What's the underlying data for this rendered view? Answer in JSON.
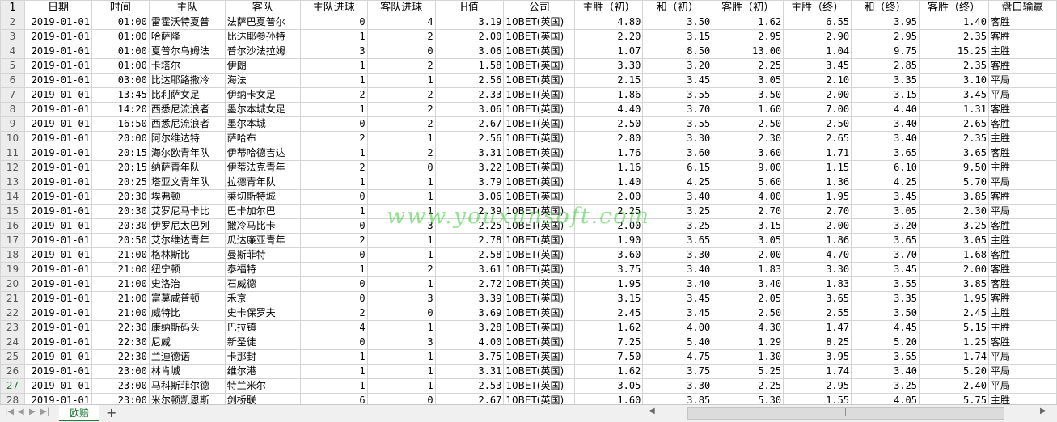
{
  "columns": [
    "日期",
    "时间",
    "主队",
    "客队",
    "主队进球",
    "客队进球",
    "H值",
    "公司",
    "主胜（初）",
    "和（初）",
    "客胜（初）",
    "主胜（终）",
    "和（终）",
    "客胜（终）",
    "盘口输赢"
  ],
  "rows": [
    [
      "2",
      "2019-01-01",
      "01:00",
      "雷霍沃特夏普",
      "法萨巴夏普尔",
      "0",
      "4",
      "3.19",
      "10BET(英国)",
      "4.80",
      "3.50",
      "1.62",
      "6.55",
      "3.95",
      "1.40",
      "客胜"
    ],
    [
      "3",
      "2019-01-01",
      "01:00",
      "哈萨隆",
      "比达耶参孙特",
      "1",
      "2",
      "2.00",
      "10BET(英国)",
      "2.20",
      "3.15",
      "2.95",
      "2.90",
      "2.95",
      "2.35",
      "客胜"
    ],
    [
      "4",
      "2019-01-01",
      "01:00",
      "夏普尔乌姆法",
      "普尔沙法拉姆",
      "3",
      "0",
      "3.06",
      "10BET(英国)",
      "1.07",
      "8.50",
      "13.00",
      "1.04",
      "9.75",
      "15.25",
      "主胜"
    ],
    [
      "5",
      "2019-01-01",
      "01:00",
      "卡塔尔",
      "伊朗",
      "1",
      "2",
      "1.58",
      "10BET(英国)",
      "3.30",
      "3.20",
      "2.25",
      "3.45",
      "2.85",
      "2.35",
      "客胜"
    ],
    [
      "6",
      "2019-01-01",
      "03:00",
      "比达耶路撒冷",
      "海法",
      "1",
      "1",
      "2.56",
      "10BET(英国)",
      "2.15",
      "3.45",
      "3.05",
      "2.10",
      "3.35",
      "3.10",
      "平局"
    ],
    [
      "7",
      "2019-01-01",
      "13:45",
      "比利萨女足",
      "伊纳卡女足",
      "2",
      "2",
      "2.33",
      "10BET(英国)",
      "1.86",
      "3.55",
      "3.50",
      "2.00",
      "3.15",
      "3.45",
      "平局"
    ],
    [
      "8",
      "2019-01-01",
      "14:20",
      "西悉尼流浪者",
      "墨尔本城女足",
      "1",
      "2",
      "3.06",
      "10BET(英国)",
      "4.40",
      "3.70",
      "1.60",
      "7.00",
      "4.40",
      "1.31",
      "客胜"
    ],
    [
      "9",
      "2019-01-01",
      "16:50",
      "西悉尼流浪者",
      "墨尔本城",
      "0",
      "2",
      "2.67",
      "10BET(英国)",
      "2.50",
      "3.55",
      "2.50",
      "2.50",
      "3.40",
      "2.65",
      "客胜"
    ],
    [
      "10",
      "2019-01-01",
      "20:00",
      "阿尔维达特",
      "萨哈布",
      "2",
      "1",
      "2.56",
      "10BET(英国)",
      "2.80",
      "3.30",
      "2.30",
      "2.65",
      "3.40",
      "2.35",
      "主胜"
    ],
    [
      "11",
      "2019-01-01",
      "20:15",
      "海尔欧青年队",
      "伊蒂哈德吉达",
      "1",
      "2",
      "3.31",
      "10BET(英国)",
      "1.76",
      "3.60",
      "3.60",
      "1.71",
      "3.65",
      "3.65",
      "客胜"
    ],
    [
      "12",
      "2019-01-01",
      "20:15",
      "纳萨青年队",
      "伊蒂法克青年",
      "2",
      "0",
      "3.22",
      "10BET(英国)",
      "1.16",
      "6.15",
      "9.00",
      "1.15",
      "6.10",
      "9.50",
      "主胜"
    ],
    [
      "13",
      "2019-01-01",
      "20:25",
      "塔亚文青年队",
      "拉德青年队",
      "1",
      "1",
      "3.79",
      "10BET(英国)",
      "1.40",
      "4.25",
      "5.60",
      "1.36",
      "4.25",
      "5.70",
      "平局"
    ],
    [
      "14",
      "2019-01-01",
      "20:30",
      "埃弗顿",
      "莱切斯特城",
      "0",
      "1",
      "3.06",
      "10BET(英国)",
      "2.00",
      "3.40",
      "4.00",
      "1.95",
      "3.45",
      "3.85",
      "客胜"
    ],
    [
      "15",
      "2019-01-01",
      "20:30",
      "艾罗尼马卡比",
      "巴卡加尔巴",
      "1",
      "1",
      "2.39",
      "10BET(英国)",
      "2.25",
      "3.25",
      "2.70",
      "2.70",
      "3.05",
      "2.30",
      "平局"
    ],
    [
      "16",
      "2019-01-01",
      "20:30",
      "伊罗尼太巴列",
      "撒冷马比卡",
      "0",
      "3",
      "2.25",
      "10BET(英国)",
      "2.00",
      "3.25",
      "3.15",
      "2.00",
      "3.20",
      "3.25",
      "客胜"
    ],
    [
      "17",
      "2019-01-01",
      "20:50",
      "艾尔维达青年",
      "瓜达廉亚青年",
      "2",
      "1",
      "2.78",
      "10BET(英国)",
      "1.90",
      "3.65",
      "3.05",
      "1.86",
      "3.65",
      "3.05",
      "主胜"
    ],
    [
      "18",
      "2019-01-01",
      "21:00",
      "格林斯比",
      "曼斯菲特",
      "0",
      "1",
      "2.58",
      "10BET(英国)",
      "3.60",
      "3.30",
      "2.00",
      "4.70",
      "3.70",
      "1.68",
      "客胜"
    ],
    [
      "19",
      "2019-01-01",
      "21:00",
      "纽宁顿",
      "泰福特",
      "1",
      "2",
      "3.61",
      "10BET(英国)",
      "3.75",
      "3.40",
      "1.83",
      "3.30",
      "3.45",
      "2.00",
      "客胜"
    ],
    [
      "20",
      "2019-01-01",
      "21:00",
      "史洛治",
      "石威德",
      "0",
      "1",
      "2.72",
      "10BET(英国)",
      "1.95",
      "3.40",
      "3.40",
      "1.83",
      "3.55",
      "3.85",
      "客胜"
    ],
    [
      "21",
      "2019-01-01",
      "21:00",
      "富莫咸普顿",
      "禾京",
      "0",
      "3",
      "3.39",
      "10BET(英国)",
      "3.15",
      "3.45",
      "2.05",
      "3.65",
      "3.35",
      "1.95",
      "客胜"
    ],
    [
      "22",
      "2019-01-01",
      "21:00",
      "威特比",
      "史卡保罗夫",
      "2",
      "0",
      "3.69",
      "10BET(英国)",
      "2.45",
      "3.45",
      "2.50",
      "2.55",
      "3.50",
      "2.45",
      "主胜"
    ],
    [
      "23",
      "2019-01-01",
      "22:30",
      "康纳斯码头",
      "巴拉镇",
      "4",
      "1",
      "3.28",
      "10BET(英国)",
      "1.62",
      "4.00",
      "4.30",
      "1.47",
      "4.45",
      "5.15",
      "主胜"
    ],
    [
      "24",
      "2019-01-01",
      "22:30",
      "尼威",
      "新圣徒",
      "0",
      "3",
      "4.00",
      "10BET(英国)",
      "7.25",
      "5.40",
      "1.29",
      "8.25",
      "5.20",
      "1.25",
      "客胜"
    ],
    [
      "25",
      "2019-01-01",
      "22:30",
      "兰迪德诺",
      "卡那封",
      "1",
      "1",
      "3.75",
      "10BET(英国)",
      "7.50",
      "4.75",
      "1.30",
      "3.95",
      "3.55",
      "1.74",
      "平局"
    ],
    [
      "26",
      "2019-01-01",
      "23:00",
      "林肯城",
      "维尔港",
      "1",
      "1",
      "3.31",
      "10BET(英国)",
      "1.62",
      "3.75",
      "5.25",
      "1.74",
      "3.40",
      "5.20",
      "平局"
    ],
    [
      "27",
      "2019-01-01",
      "23:00",
      "马科斯菲尔德",
      "特兰米尔",
      "1",
      "1",
      "2.53",
      "10BET(英国)",
      "3.05",
      "3.30",
      "2.25",
      "2.95",
      "3.25",
      "2.40",
      "平局"
    ],
    [
      "28",
      "2019-01-01",
      "23:00",
      "米尔顿凯恩斯",
      "剑桥联",
      "6",
      "0",
      "2.67",
      "10BET(英国)",
      "1.60",
      "3.85",
      "5.30",
      "1.55",
      "4.05",
      "5.75",
      "主胜"
    ]
  ],
  "header_row_num": "1",
  "active_row": "27",
  "sheet_tab": "欧赔",
  "add_sheet": "+",
  "watermark": "www.youxunsoft.com",
  "accent_color": "#1f7a3a"
}
